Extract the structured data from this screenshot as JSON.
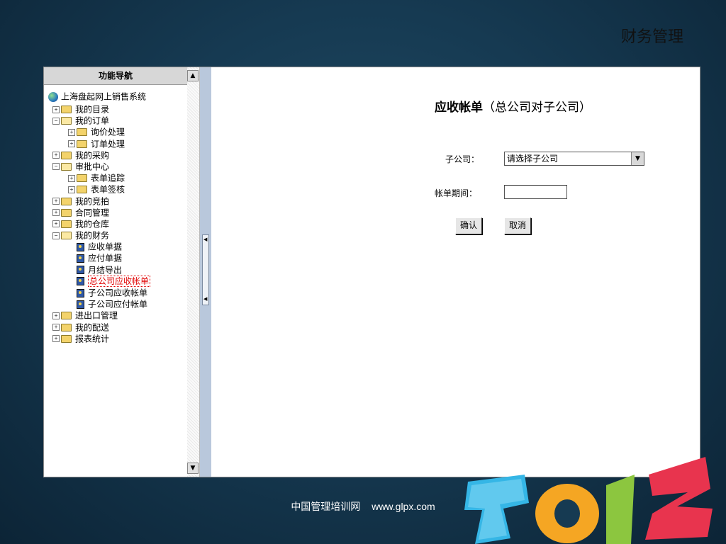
{
  "slide": {
    "title": "财务管理",
    "footer_site": "中国管理培训网",
    "footer_url": "www.glpx.com"
  },
  "nav": {
    "header": "功能导航",
    "root": "上海盘起网上销售系统",
    "items": [
      {
        "level": 1,
        "toggle": "+",
        "icon": "folder",
        "label": "我的目录"
      },
      {
        "level": 1,
        "toggle": "-",
        "icon": "folder-open",
        "label": "我的订单"
      },
      {
        "level": 2,
        "toggle": "+",
        "icon": "folder",
        "label": "询价处理"
      },
      {
        "level": 2,
        "toggle": "+",
        "icon": "folder",
        "label": "订单处理"
      },
      {
        "level": 1,
        "toggle": "+",
        "icon": "folder",
        "label": "我的采购"
      },
      {
        "level": 1,
        "toggle": "-",
        "icon": "folder-open",
        "label": "审批中心"
      },
      {
        "level": 2,
        "toggle": "+",
        "icon": "folder",
        "label": "表单追踪"
      },
      {
        "level": 2,
        "toggle": "+",
        "icon": "folder",
        "label": "表单签核"
      },
      {
        "level": 1,
        "toggle": "+",
        "icon": "folder",
        "label": "我的竞拍"
      },
      {
        "level": 1,
        "toggle": "+",
        "icon": "folder",
        "label": "合同管理"
      },
      {
        "level": 1,
        "toggle": "+",
        "icon": "folder",
        "label": "我的仓库"
      },
      {
        "level": 1,
        "toggle": "-",
        "icon": "folder-open",
        "label": "我的财务"
      },
      {
        "level": 2,
        "toggle": "",
        "icon": "document",
        "label": "应收单据"
      },
      {
        "level": 2,
        "toggle": "",
        "icon": "document",
        "label": "应付单据"
      },
      {
        "level": 2,
        "toggle": "",
        "icon": "document",
        "label": "月结导出"
      },
      {
        "level": 2,
        "toggle": "",
        "icon": "document",
        "label": "总公司应收帐单",
        "selected": true
      },
      {
        "level": 2,
        "toggle": "",
        "icon": "document",
        "label": "子公司应收帐单"
      },
      {
        "level": 2,
        "toggle": "",
        "icon": "document",
        "label": "子公司应付帐单"
      },
      {
        "level": 1,
        "toggle": "+",
        "icon": "folder",
        "label": "进出口管理"
      },
      {
        "level": 1,
        "toggle": "+",
        "icon": "folder",
        "label": "我的配送"
      },
      {
        "level": 1,
        "toggle": "+",
        "icon": "folder",
        "label": "报表统计"
      }
    ]
  },
  "form": {
    "title_bold": "应收帐单",
    "title_rest": "（总公司对子公司）",
    "subsidiary_label": "子公司：",
    "subsidiary_value": "请选择子公司",
    "period_label": "帐单期间：",
    "period_value": "",
    "confirm_label": "确认",
    "cancel_label": "取消"
  },
  "colors": {
    "selected_text": "#e00000",
    "splitter": "#b9c8dc",
    "background": "#163a52"
  }
}
